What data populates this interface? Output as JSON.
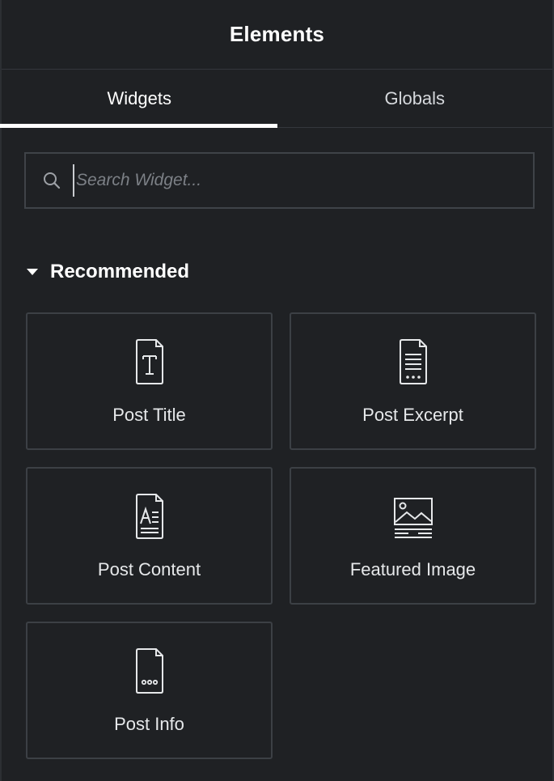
{
  "header": {
    "title": "Elements"
  },
  "tabs": [
    {
      "label": "Widgets",
      "active": true
    },
    {
      "label": "Globals",
      "active": false
    }
  ],
  "search": {
    "placeholder": "Search Widget...",
    "value": "",
    "icon": "search-icon"
  },
  "section": {
    "title": "Recommended",
    "expanded": true,
    "icon": "caret-down-icon"
  },
  "widgets": [
    {
      "label": "Post Title",
      "icon": "post-title-icon"
    },
    {
      "label": "Post Excerpt",
      "icon": "post-excerpt-icon"
    },
    {
      "label": "Post Content",
      "icon": "post-content-icon"
    },
    {
      "label": "Featured Image",
      "icon": "featured-image-icon"
    },
    {
      "label": "Post Info",
      "icon": "post-info-icon"
    }
  ],
  "colors": {
    "background": "#1f2124",
    "border": "#3c4045",
    "text": "#e6e8ea",
    "active_tab_indicator": "#ffffff"
  }
}
